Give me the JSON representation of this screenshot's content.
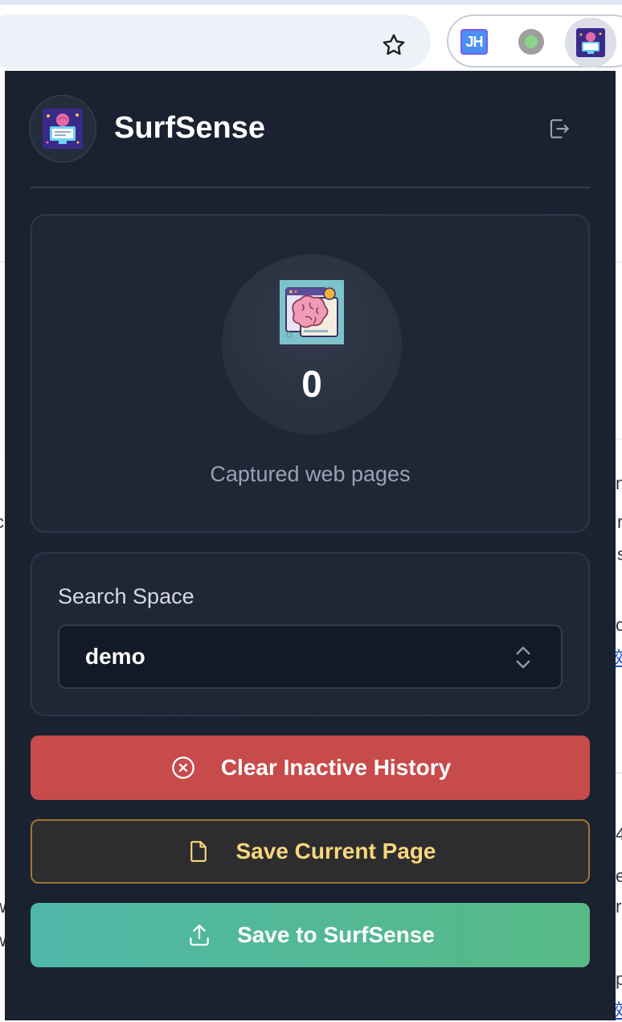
{
  "browser": {
    "extensions": [
      {
        "name": "jh-extension",
        "label": "JH"
      },
      {
        "name": "green-dot-extension",
        "label": ""
      },
      {
        "name": "surfsense-extension",
        "label": ""
      }
    ]
  },
  "background_page": {
    "right_fragments": [
      "nc",
      "r",
      "s",
      "c",
      "4",
      "e",
      "re",
      "p"
    ],
    "left_fragments": [
      "c",
      "i",
      "w",
      "w"
    ],
    "links": [
      "效",
      "效"
    ]
  },
  "popup": {
    "header": {
      "title": "SurfSense",
      "logout_icon": "logout-icon"
    },
    "stats": {
      "count": "0",
      "label": "Captured web pages",
      "icon": "brain-browser-icon"
    },
    "search_space": {
      "label": "Search Space",
      "selected": "demo",
      "icon": "chevron-up-down-icon"
    },
    "actions": {
      "clear_label": "Clear Inactive History",
      "save_page_label": "Save Current Page",
      "save_surfsense_label": "Save to SurfSense"
    },
    "colors": {
      "background": "#1a2130",
      "clear_button": "#c84b4b",
      "save_page_text": "#f7d77a",
      "save_page_border": "#a3752e",
      "save_surfsense_from": "#4fb7a8",
      "save_surfsense_to": "#57b985"
    }
  }
}
